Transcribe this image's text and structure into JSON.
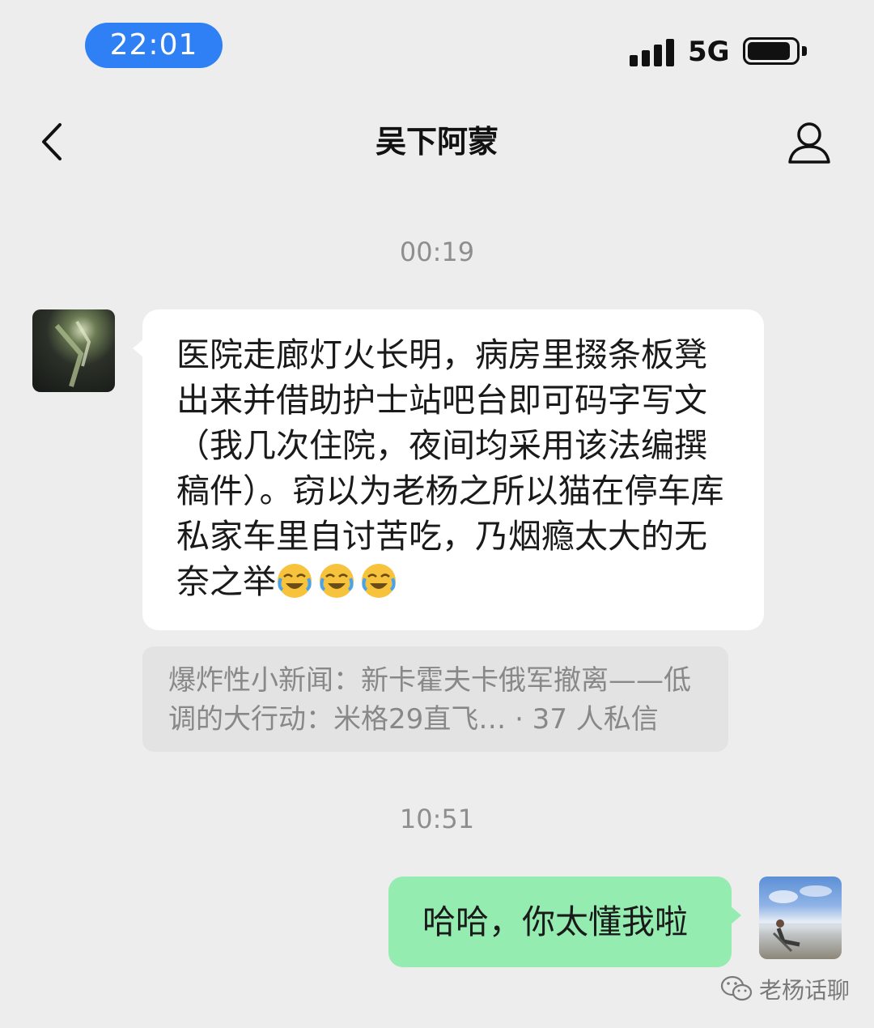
{
  "status_bar": {
    "time": "22:01",
    "network": "5G",
    "signal_icon": "signal-icon",
    "battery_icon": "battery-icon"
  },
  "nav": {
    "title": "吴下阿蒙",
    "back_icon": "back-icon",
    "profile_icon": "profile-icon"
  },
  "messages": [
    {
      "timestamp": "00:19",
      "sender": "contact",
      "text": "医院走廊灯火长明，病房里掇条板凳出来并借助护士站吧台即可码字写文（我几次住院，夜间均采用该法编撰稿件）。窃以为老杨之所以猫在停车库私家车里自讨苦吃，乃烟瘾太大的无奈之举",
      "trailing_emoji": [
        "laugh-cry-emoji",
        "laugh-cry-emoji",
        "laugh-cry-emoji"
      ],
      "quote": "爆炸性小新闻：新卡霍夫卡俄军撤离——低调的大行动：米格29直飞… · 37 人私信"
    },
    {
      "timestamp": "10:51",
      "sender": "me",
      "text": "哈哈，你太懂我啦"
    }
  ],
  "watermark": {
    "text": "老杨话聊",
    "icon": "wechat-icon"
  },
  "colors": {
    "time_pill": "#2f80f5",
    "background": "#ededed",
    "outgoing_bubble": "#95ecb0",
    "incoming_bubble": "#ffffff"
  }
}
